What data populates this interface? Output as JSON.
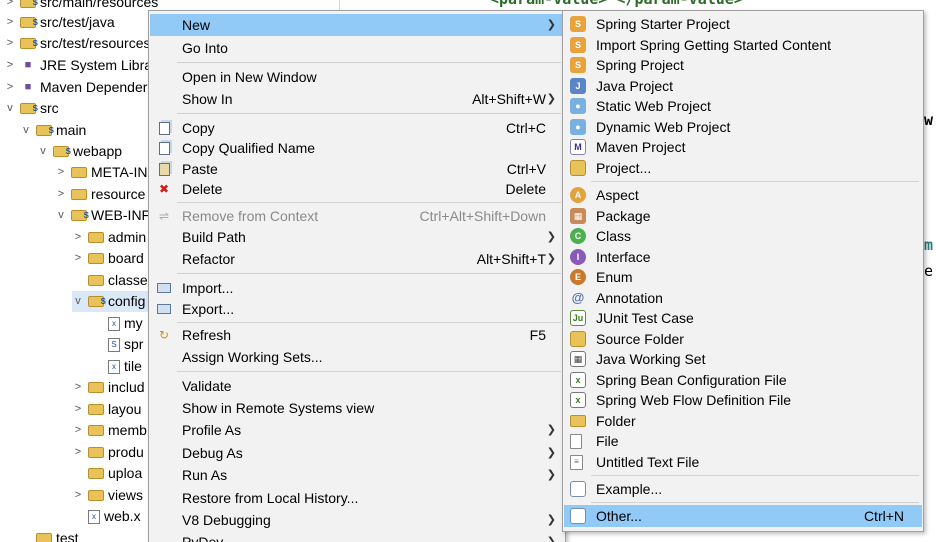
{
  "tree": {
    "items": [
      {
        "label": "src/main/resources",
        "twisty": ">",
        "icon": "source-folder-icon"
      },
      {
        "label": "src/test/java",
        "twisty": ">",
        "icon": "source-folder-icon"
      },
      {
        "label": "src/test/resources",
        "twisty": ">",
        "icon": "source-folder-icon"
      },
      {
        "label": "JRE System Librar",
        "twisty": ">",
        "icon": "library-icon"
      },
      {
        "label": "Maven Depender",
        "twisty": ">",
        "icon": "library-icon"
      },
      {
        "label": "src",
        "twisty": "v",
        "icon": "folder-icon"
      },
      {
        "label": "main",
        "twisty": "v",
        "icon": "folder-icon"
      },
      {
        "label": "webapp",
        "twisty": "v",
        "icon": "folder-icon"
      },
      {
        "label": "META-IN",
        "twisty": ">",
        "icon": "folder-icon"
      },
      {
        "label": "resource",
        "twisty": ">",
        "icon": "folder-icon"
      },
      {
        "label": "WEB-INF",
        "twisty": "v",
        "icon": "folder-icon"
      },
      {
        "label": "admin",
        "twisty": ">",
        "icon": "folder-icon"
      },
      {
        "label": "board",
        "twisty": ">",
        "icon": "folder-icon"
      },
      {
        "label": "classe",
        "twisty": "",
        "icon": "folder-icon"
      },
      {
        "label": "config",
        "twisty": "v",
        "icon": "folder-icon"
      },
      {
        "label": "my",
        "twisty": "",
        "icon": "xml-file-icon"
      },
      {
        "label": "spr",
        "twisty": "",
        "icon": "spring-xml-icon"
      },
      {
        "label": "tile",
        "twisty": "",
        "icon": "xml-file-icon"
      },
      {
        "label": "includ",
        "twisty": ">",
        "icon": "folder-icon"
      },
      {
        "label": "layou",
        "twisty": ">",
        "icon": "folder-icon"
      },
      {
        "label": "memb",
        "twisty": ">",
        "icon": "folder-icon"
      },
      {
        "label": "produ",
        "twisty": ">",
        "icon": "folder-icon"
      },
      {
        "label": "uploa",
        "twisty": "",
        "icon": "folder-icon"
      },
      {
        "label": "views",
        "twisty": ">",
        "icon": "folder-icon"
      },
      {
        "label": "web.x",
        "twisty": "",
        "icon": "xml-file-icon"
      },
      {
        "label": "test",
        "twisty": "",
        "icon": "folder-icon"
      }
    ]
  },
  "editor": {
    "top_text": "<param-value> </param-value>",
    "fragment_w": "w",
    "fragment_m": "m",
    "fragment_e": "e"
  },
  "context_menu": {
    "items": [
      {
        "label": "New",
        "shortcut": "",
        "submenu": true
      },
      {
        "label": "Go Into",
        "shortcut": ""
      },
      {
        "label": "Open in New Window",
        "shortcut": ""
      },
      {
        "label": "Show In",
        "shortcut": "Alt+Shift+W",
        "submenu": true
      },
      {
        "label": "Copy",
        "shortcut": "Ctrl+C"
      },
      {
        "label": "Copy Qualified Name",
        "shortcut": ""
      },
      {
        "label": "Paste",
        "shortcut": "Ctrl+V"
      },
      {
        "label": "Delete",
        "shortcut": "Delete"
      },
      {
        "label": "Remove from Context",
        "shortcut": "Ctrl+Alt+Shift+Down"
      },
      {
        "label": "Build Path",
        "shortcut": "",
        "submenu": true
      },
      {
        "label": "Refactor",
        "shortcut": "Alt+Shift+T",
        "submenu": true
      },
      {
        "label": "Import...",
        "shortcut": ""
      },
      {
        "label": "Export...",
        "shortcut": ""
      },
      {
        "label": "Refresh",
        "shortcut": "F5"
      },
      {
        "label": "Assign Working Sets...",
        "shortcut": ""
      },
      {
        "label": "Validate",
        "shortcut": ""
      },
      {
        "label": "Show in Remote Systems view",
        "shortcut": ""
      },
      {
        "label": "Profile As",
        "shortcut": "",
        "submenu": true
      },
      {
        "label": "Debug As",
        "shortcut": "",
        "submenu": true
      },
      {
        "label": "Run As",
        "shortcut": "",
        "submenu": true
      },
      {
        "label": "Restore from Local History...",
        "shortcut": ""
      },
      {
        "label": "V8 Debugging",
        "shortcut": "",
        "submenu": true
      },
      {
        "label": "PyDev",
        "shortcut": "",
        "submenu": true
      }
    ]
  },
  "new_submenu": {
    "items": [
      {
        "label": "Spring Starter Project",
        "icon": "spring-project-icon"
      },
      {
        "label": "Import Spring Getting Started Content",
        "icon": "spring-import-icon"
      },
      {
        "label": "Spring Project",
        "icon": "spring-project-icon"
      },
      {
        "label": "Java Project",
        "icon": "java-project-icon"
      },
      {
        "label": "Static Web Project",
        "icon": "static-web-project-icon"
      },
      {
        "label": "Dynamic Web Project",
        "icon": "dynamic-web-project-icon"
      },
      {
        "label": "Maven Project",
        "icon": "maven-project-icon"
      },
      {
        "label": "Project...",
        "icon": "project-icon"
      },
      {
        "label": "Aspect",
        "icon": "aspect-icon"
      },
      {
        "label": "Package",
        "icon": "package-icon"
      },
      {
        "label": "Class",
        "icon": "class-icon"
      },
      {
        "label": "Interface",
        "icon": "interface-icon"
      },
      {
        "label": "Enum",
        "icon": "enum-icon"
      },
      {
        "label": "Annotation",
        "icon": "annotation-icon"
      },
      {
        "label": "JUnit Test Case",
        "icon": "junit-icon"
      },
      {
        "label": "Source Folder",
        "icon": "source-folder-icon"
      },
      {
        "label": "Java Working Set",
        "icon": "working-set-icon"
      },
      {
        "label": "Spring Bean Configuration File",
        "icon": "spring-bean-icon"
      },
      {
        "label": "Spring Web Flow Definition File",
        "icon": "web-flow-icon"
      },
      {
        "label": "Folder",
        "icon": "folder-icon"
      },
      {
        "label": "File",
        "icon": "file-icon"
      },
      {
        "label": "Untitled Text File",
        "icon": "text-file-icon"
      },
      {
        "label": "Example...",
        "icon": "example-icon"
      },
      {
        "label": "Other...",
        "icon": "other-wizard-icon",
        "shortcut": "Ctrl+N"
      }
    ]
  }
}
